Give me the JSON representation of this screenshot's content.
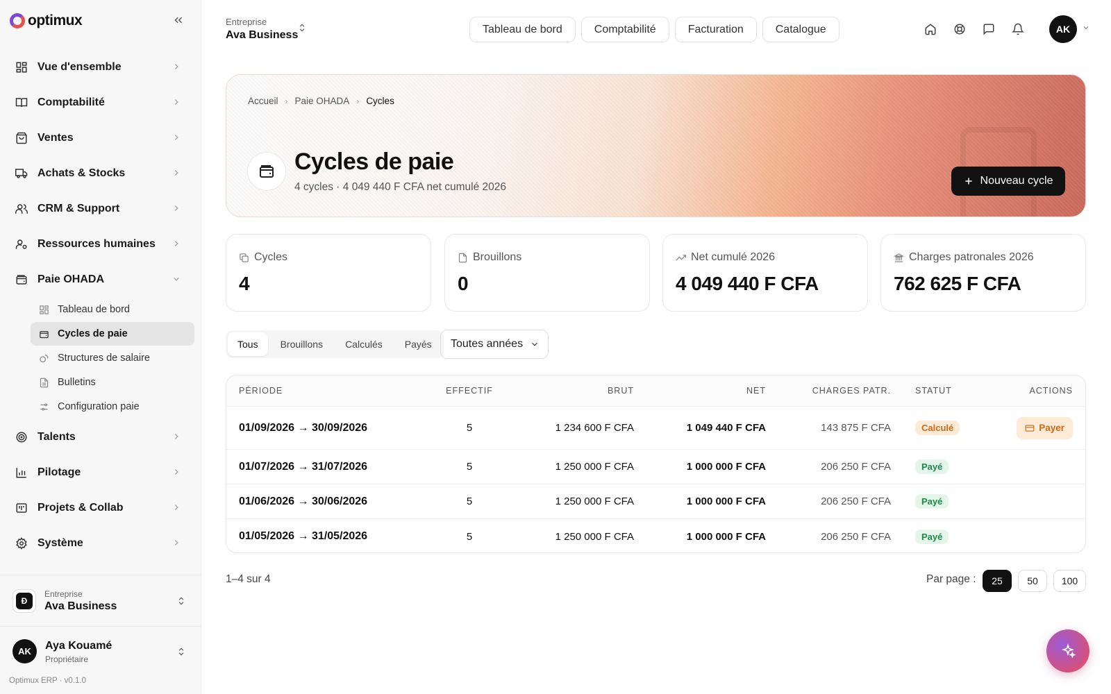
{
  "brand": {
    "name": "optimux"
  },
  "sidebar": {
    "items": [
      {
        "label": "Vue d'ensemble",
        "icon": "grid-icon"
      },
      {
        "label": "Comptabilité",
        "icon": "book-icon"
      },
      {
        "label": "Ventes",
        "icon": "shopping-bag-icon"
      },
      {
        "label": "Achats & Stocks",
        "icon": "truck-icon"
      },
      {
        "label": "CRM & Support",
        "icon": "users-icon"
      },
      {
        "label": "Ressources humaines",
        "icon": "user-cog-icon"
      },
      {
        "label": "Paie OHADA",
        "icon": "wallet-icon"
      },
      {
        "label": "Talents",
        "icon": "target-icon"
      },
      {
        "label": "Pilotage",
        "icon": "bar-chart-icon"
      },
      {
        "label": "Projets & Collab",
        "icon": "kanban-icon"
      },
      {
        "label": "Système",
        "icon": "gear-icon"
      }
    ],
    "paie_sub": [
      {
        "label": "Tableau de bord",
        "icon": "grid-icon"
      },
      {
        "label": "Cycles de paie",
        "icon": "wallet-icon"
      },
      {
        "label": "Structures de salaire",
        "icon": "coins-icon"
      },
      {
        "label": "Bulletins",
        "icon": "file-text-icon"
      },
      {
        "label": "Configuration paie",
        "icon": "sliders-icon"
      }
    ],
    "company": {
      "caption": "Entreprise",
      "name": "Ava Business"
    },
    "user": {
      "initials": "AK",
      "name": "Aya Kouamé",
      "role": "Propriétaire"
    },
    "version": "Optimux ERP · v0.1.0"
  },
  "topbar": {
    "org_caption": "Entreprise",
    "org_name": "Ava Business",
    "nav": [
      "Tableau de bord",
      "Comptabilité",
      "Facturation",
      "Catalogue"
    ],
    "icons": [
      "home-icon",
      "lifebuoy-icon",
      "message-icon",
      "bell-icon"
    ],
    "avatar": "AK"
  },
  "hero": {
    "breadcrumb": [
      "Accueil",
      "Paie OHADA",
      "Cycles"
    ],
    "title": "Cycles de paie",
    "subtitle": "4 cycles · 4 049 440 F CFA net cumulé 2026",
    "new_button": "Nouveau cycle"
  },
  "stats": [
    {
      "label": "Cycles",
      "value": "4",
      "icon": "copy-icon"
    },
    {
      "label": "Brouillons",
      "value": "0",
      "icon": "file-icon"
    },
    {
      "label": "Net cumulé 2026",
      "value": "4 049 440 F CFA",
      "icon": "trending-up-icon"
    },
    {
      "label": "Charges patronales 2026",
      "value": "762 625 F CFA",
      "icon": "landmark-icon"
    }
  ],
  "filters": {
    "tabs": [
      "Tous",
      "Brouillons",
      "Calculés",
      "Payés"
    ],
    "active_tab": "Tous",
    "year": "Toutes années"
  },
  "table": {
    "headers": [
      "PÉRIODE",
      "EFFECTIF",
      "BRUT",
      "NET",
      "CHARGES PATR.",
      "STATUT",
      "ACTIONS"
    ],
    "rows": [
      {
        "period": "01/09/2026 → 30/09/2026",
        "effectif": "5",
        "brut": "1 234 600 F CFA",
        "net": "1 049 440 F CFA",
        "charges": "143 875 F CFA",
        "status": "Calculé",
        "action": "Payer"
      },
      {
        "period": "01/07/2026 → 31/07/2026",
        "effectif": "5",
        "brut": "1 250 000 F CFA",
        "net": "1 000 000 F CFA",
        "charges": "206 250 F CFA",
        "status": "Payé",
        "action": ""
      },
      {
        "period": "01/06/2026 → 30/06/2026",
        "effectif": "5",
        "brut": "1 250 000 F CFA",
        "net": "1 000 000 F CFA",
        "charges": "206 250 F CFA",
        "status": "Payé",
        "action": ""
      },
      {
        "period": "01/05/2026 → 31/05/2026",
        "effectif": "5",
        "brut": "1 250 000 F CFA",
        "net": "1 000 000 F CFA",
        "charges": "206 250 F CFA",
        "status": "Payé",
        "action": ""
      }
    ]
  },
  "pagination": {
    "range": "1–4 sur 4",
    "per_page_label": "Par page :",
    "options": [
      "25",
      "50",
      "100"
    ],
    "selected": "25"
  },
  "colors": {
    "accent": "#111111",
    "calc_badge": "#cc6a13",
    "paid_badge": "#1e8a47"
  }
}
